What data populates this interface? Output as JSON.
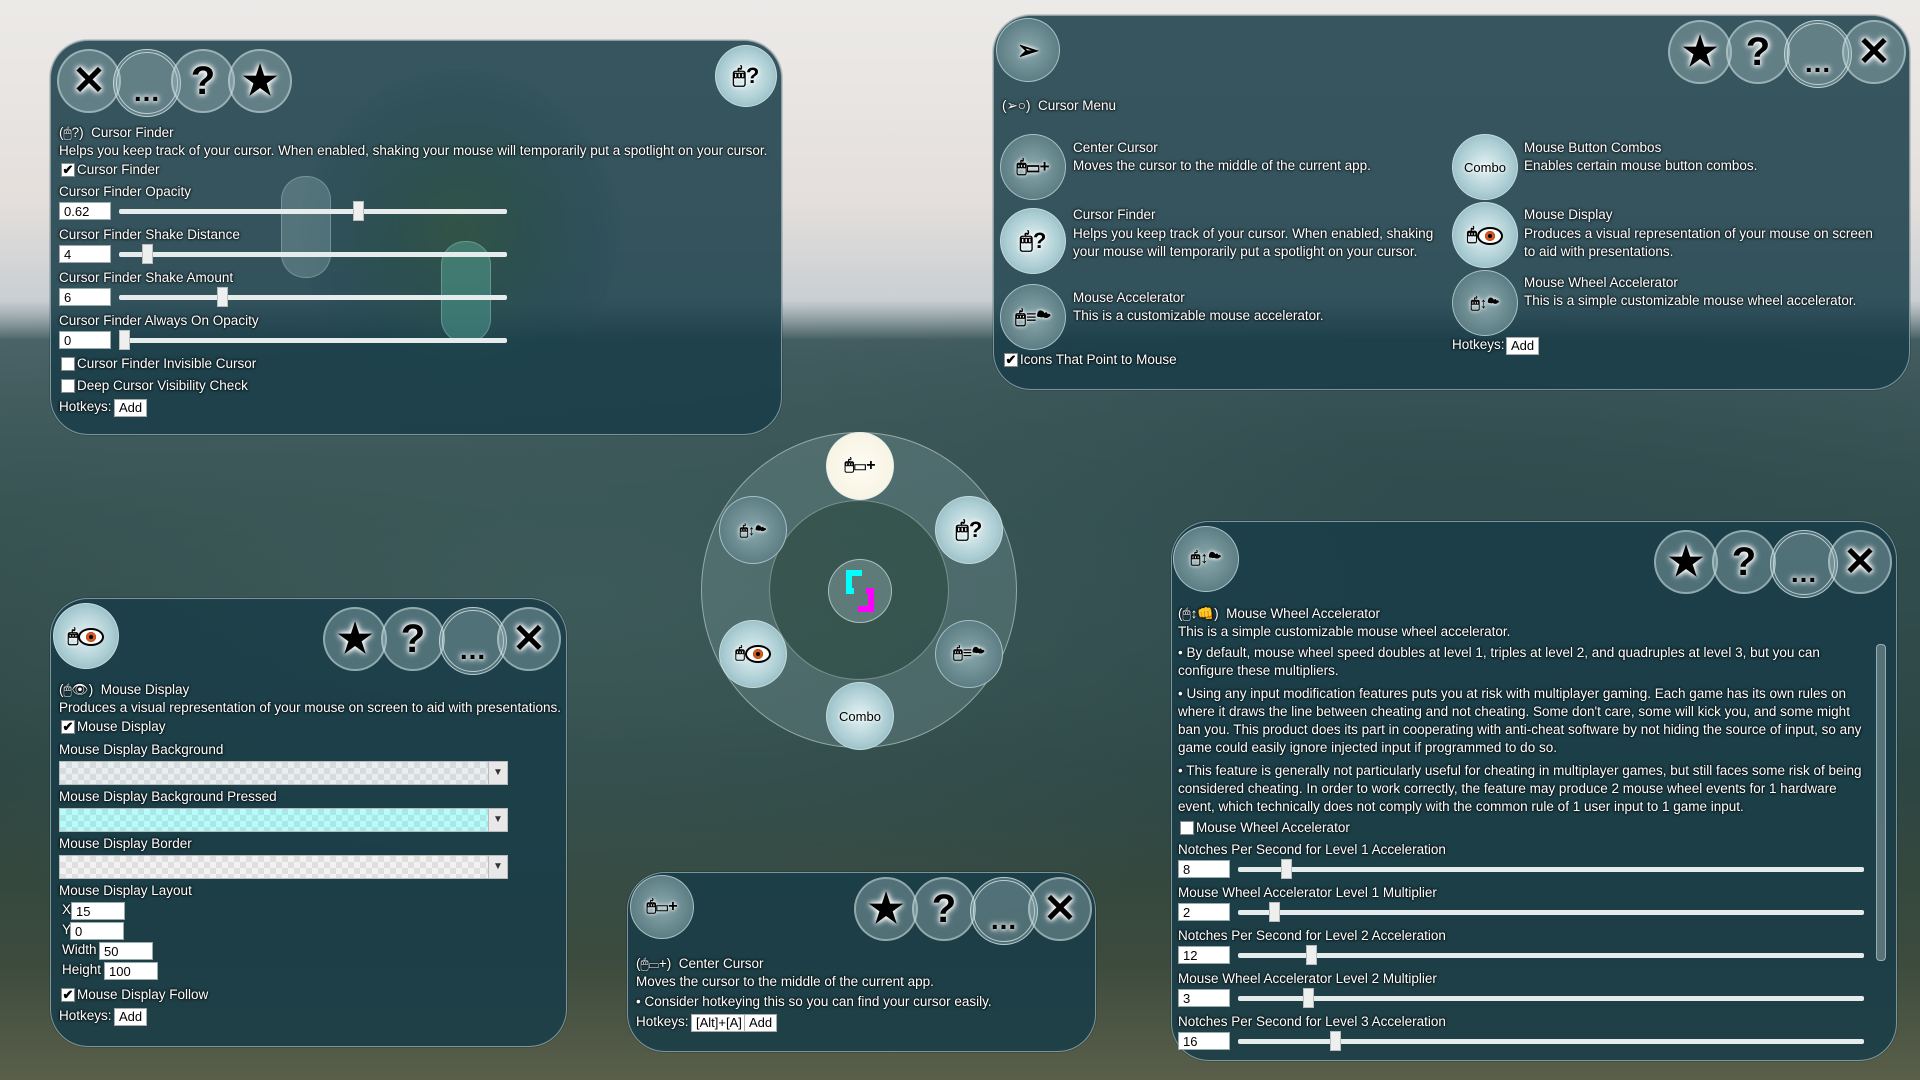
{
  "common": {
    "close_glyph": "✕",
    "more_glyph": "...",
    "help_glyph": "?",
    "favorite_glyph": "★",
    "check_glyph": "✔",
    "hotkeys_label": "Hotkeys:",
    "add_label": "Add",
    "combo_icon_text": "Combo"
  },
  "cursor_finder_panel": {
    "icon_label": "(🖱?)",
    "title": "Cursor Finder",
    "description": "Helps you keep track of your cursor.  When enabled, shaking your mouse will temporarily put a spotlight on your cursor.",
    "enable_checkbox": {
      "label": "Cursor Finder",
      "checked": true
    },
    "sliders": [
      {
        "label": "Cursor Finder Opacity",
        "value": "0.62",
        "fraction": 0.62
      },
      {
        "label": "Cursor Finder Shake Distance",
        "value": "4",
        "fraction": 0.06
      },
      {
        "label": "Cursor Finder Shake Amount",
        "value": "6",
        "fraction": 0.26
      },
      {
        "label": "Cursor Finder Always On Opacity",
        "value": "0",
        "fraction": 0.0
      }
    ],
    "checkboxes": [
      {
        "label": "Cursor Finder Invisible Cursor",
        "checked": false
      },
      {
        "label": "Deep Cursor Visibility Check",
        "checked": false
      }
    ]
  },
  "cursor_menu_panel": {
    "icon_label": "(➢○)",
    "title": "Cursor Menu",
    "items_left": [
      {
        "title": "Center Cursor",
        "description": "Moves the cursor to the middle of the current app.",
        "icon": "center-cursor-icon"
      },
      {
        "title": "Cursor Finder",
        "description": "Helps you keep track of your cursor.  When enabled, shaking your mouse will temporarily put a spotlight on your cursor.",
        "icon": "cursor-finder-icon"
      },
      {
        "title": "Mouse Accelerator",
        "description": "This is a customizable mouse accelerator.",
        "icon": "mouse-accelerator-icon"
      }
    ],
    "items_right": [
      {
        "title": "Mouse Button Combos",
        "description": "Enables certain mouse button combos.",
        "icon": "combo-icon"
      },
      {
        "title": "Mouse Display",
        "description": "Produces a visual representation of your mouse on screen to aid with presentations.",
        "icon": "mouse-display-icon"
      },
      {
        "title": "Mouse Wheel Accelerator",
        "description": "This is a simple customizable mouse wheel accelerator.",
        "icon": "mouse-wheel-accelerator-icon"
      }
    ],
    "checkbox": {
      "label": "Icons That Point to Mouse",
      "checked": true
    }
  },
  "mouse_display_panel": {
    "icon_label": "(🖱👁)",
    "title": "Mouse Display",
    "description": "Produces a visual representation of your mouse on screen to aid with presentations.",
    "enable_checkbox": {
      "label": "Mouse Display",
      "checked": true
    },
    "color_pickers": [
      {
        "label": "Mouse Display Background",
        "color": "#e8eef0"
      },
      {
        "label": "Mouse Display Background Pressed",
        "color": "#b8fbfb"
      },
      {
        "label": "Mouse Display Border",
        "color": "#f2f2f2"
      }
    ],
    "layout_label": "Mouse Display Layout",
    "layout_fields": [
      {
        "label": "X",
        "value": "15"
      },
      {
        "label": "Y",
        "value": "0"
      },
      {
        "label": "Width",
        "value": "50"
      },
      {
        "label": "Height",
        "value": "100"
      }
    ],
    "follow_checkbox": {
      "label": "Mouse Display Follow",
      "checked": true
    }
  },
  "center_cursor_panel": {
    "icon_label": "(🖱▭+)",
    "title": "Center Cursor",
    "description": "Moves the cursor to the middle of the current app.",
    "bullet": "• Consider hotkeying this so you can find your cursor easily.",
    "hotkey": "[Alt]+[A]"
  },
  "mouse_wheel_panel": {
    "icon_label": "(🖱↕👊)",
    "title": "Mouse Wheel Accelerator",
    "description": "This is a simple customizable mouse wheel accelerator.",
    "bullets": [
      "• By default, mouse wheel speed doubles at level 1, triples at level 2, and quadruples at level 3, but you can configure these multipliers.",
      "• Using any input modification features puts you at risk with multiplayer gaming.  Each game has its own rules on where it draws the line between cheating and not cheating.  Some don't care, some will kick you, and some might ban you.  This product does its part in cooperating with anti-cheat software by not hiding the source of input, so any game could easily ignore injected input if programmed to do so.",
      "• This feature is generally not particularly useful for cheating in multiplayer games, but still faces some risk of being considered cheating.  In order to work correctly, the feature may produce 2 mouse wheel events for 1 hardware event, which technically does not comply with the common rule of 1 user input to 1 game input."
    ],
    "enable_checkbox": {
      "label": "Mouse Wheel Accelerator",
      "checked": false
    },
    "sliders": [
      {
        "label": "Notches Per Second for Level 1 Acceleration",
        "value": "8",
        "fraction": 0.07
      },
      {
        "label": "Mouse Wheel Accelerator Level 1 Multiplier",
        "value": "2",
        "fraction": 0.05
      },
      {
        "label": "Notches Per Second for Level 2 Acceleration",
        "value": "12",
        "fraction": 0.11
      },
      {
        "label": "Mouse Wheel Accelerator Level 2 Multiplier",
        "value": "3",
        "fraction": 0.105
      },
      {
        "label": "Notches Per Second for Level 3 Acceleration",
        "value": "16",
        "fraction": 0.15
      }
    ]
  },
  "radial_menu": {
    "center_icon": "app-logo-icon",
    "items": [
      "Center Cursor",
      "Cursor Finder",
      "Mouse Accelerator",
      "Mouse Button Combos",
      "Mouse Display",
      "Mouse Wheel Accelerator"
    ]
  }
}
